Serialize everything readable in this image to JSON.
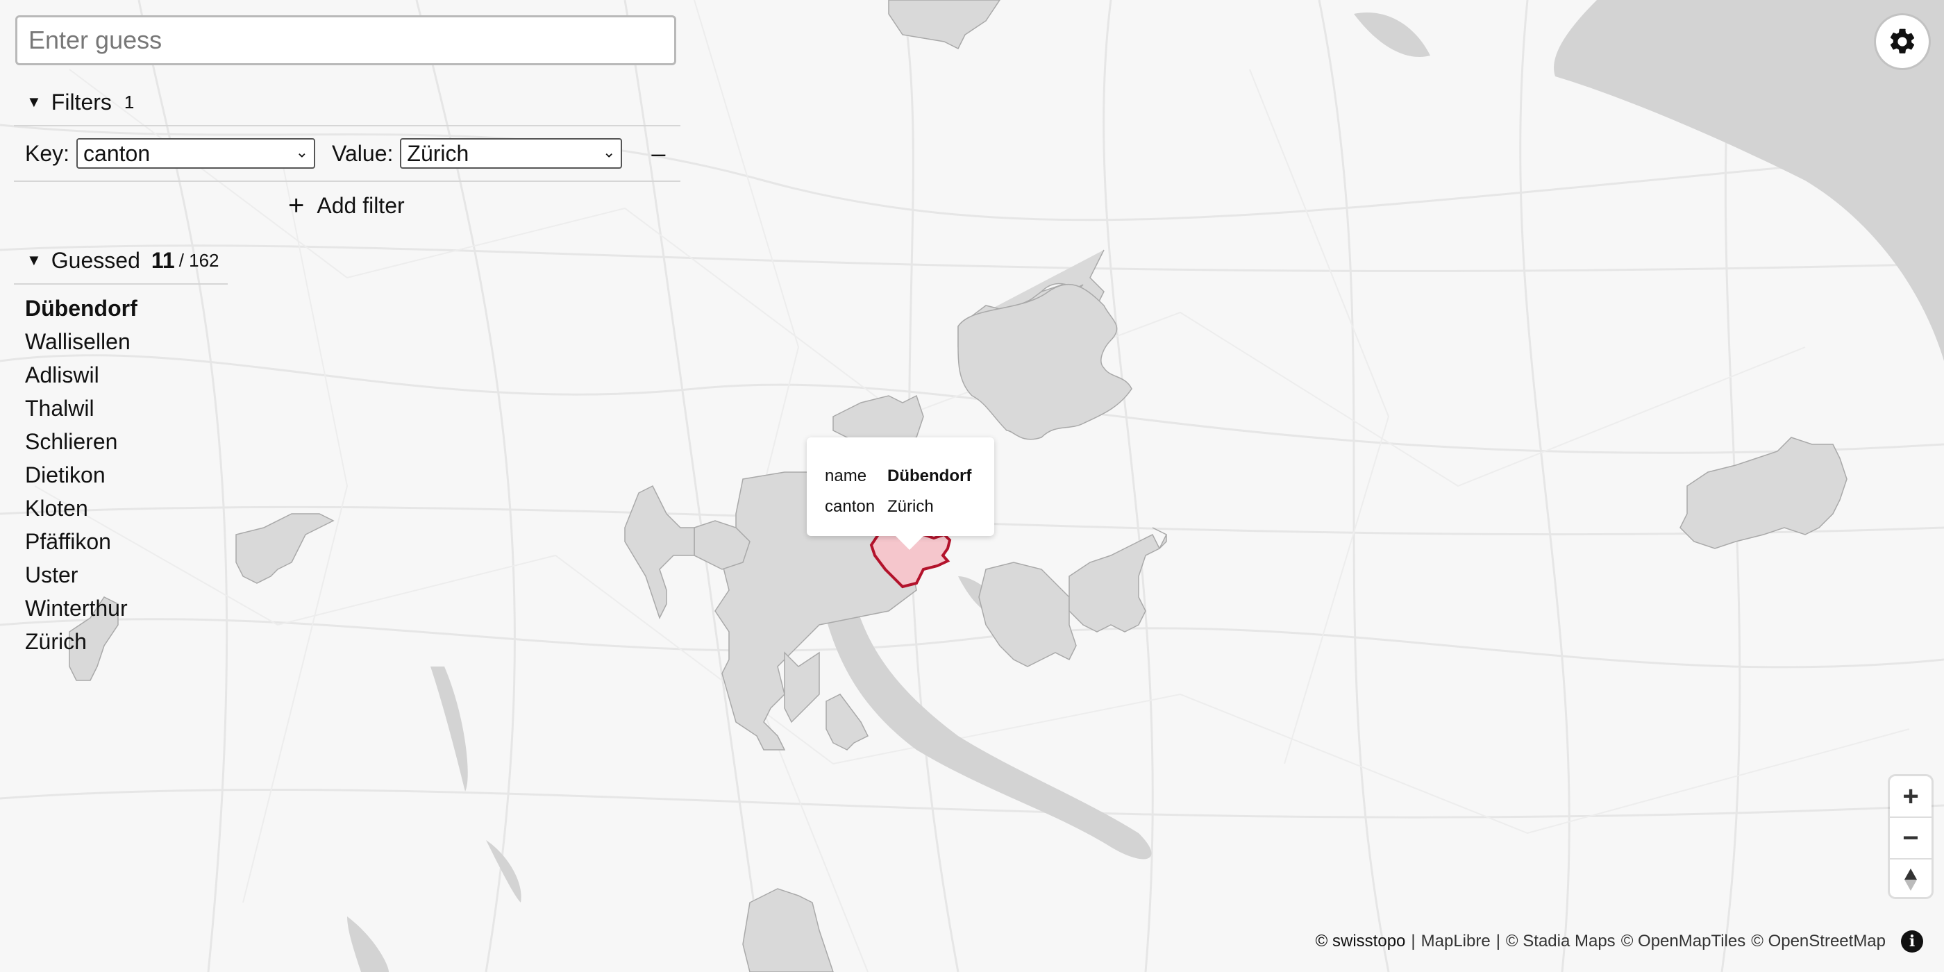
{
  "search": {
    "placeholder": "Enter guess"
  },
  "filters": {
    "label": "Filters",
    "count": "1",
    "rows": [
      {
        "key_label": "Key:",
        "key_value": "canton",
        "value_label": "Value:",
        "value_value": "Zürich"
      }
    ],
    "add_label": "Add filter"
  },
  "guessed": {
    "label": "Guessed",
    "count": "11",
    "total": "/ 162",
    "items": [
      "Dübendorf",
      "Wallisellen",
      "Adliswil",
      "Thalwil",
      "Schlieren",
      "Dietikon",
      "Kloten",
      "Pfäffikon",
      "Uster",
      "Winterthur",
      "Zürich"
    ]
  },
  "popup": {
    "name_key": "name",
    "name_value": "Dübendorf",
    "canton_key": "canton",
    "canton_value": "Zürich"
  },
  "attribution": {
    "swisstopo": "© swisstopo",
    "sep1": "|",
    "maplibre": "MapLibre",
    "sep2": "|",
    "stadia": "© Stadia Maps",
    "omt": "© OpenMapTiles",
    "osm": "© OpenStreetMap"
  },
  "icons": {
    "settings": "gear-icon",
    "zoom_in": "plus-icon",
    "zoom_out": "minus-icon",
    "compass": "compass-icon",
    "info": "info-icon"
  },
  "colors": {
    "highlight_fill": "#f5c6cc",
    "highlight_stroke": "#b3122b",
    "guessed_fill": "#d9d9d9",
    "water": "#d3d3d3"
  }
}
